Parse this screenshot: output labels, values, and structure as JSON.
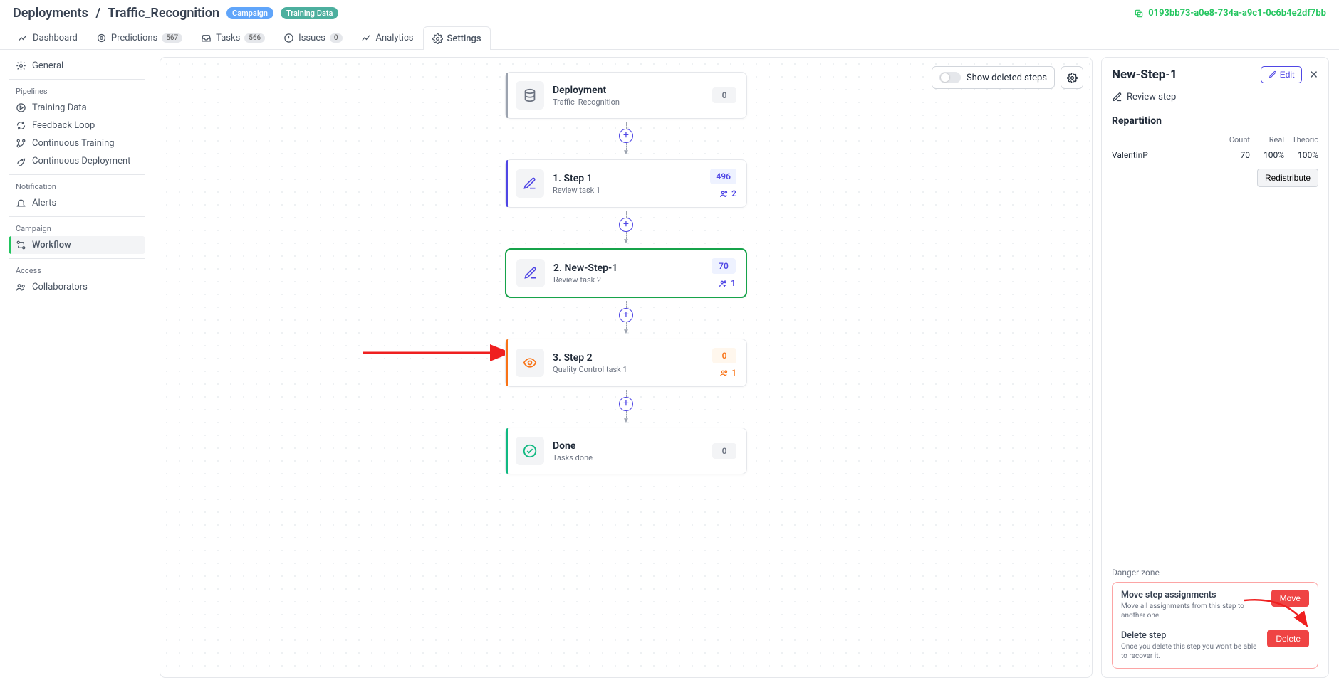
{
  "breadcrumb": {
    "root": "Deployments",
    "current": "Traffic_Recognition"
  },
  "badges": {
    "campaign": "Campaign",
    "training": "Training Data"
  },
  "identifier": "0193bb73-a0e8-734a-a9c1-0c6b4e2df7bb",
  "tabs": {
    "dashboard": "Dashboard",
    "predictions": "Predictions",
    "predictions_count": "567",
    "tasks": "Tasks",
    "tasks_count": "566",
    "issues": "Issues",
    "issues_count": "0",
    "analytics": "Analytics",
    "settings": "Settings"
  },
  "sidebar": {
    "general": "General",
    "pipelines_heading": "Pipelines",
    "training_data": "Training Data",
    "feedback_loop": "Feedback Loop",
    "continuous_training": "Continuous Training",
    "continuous_deployment": "Continuous Deployment",
    "notification_heading": "Notification",
    "alerts": "Alerts",
    "campaign_heading": "Campaign",
    "workflow": "Workflow",
    "access_heading": "Access",
    "collaborators": "Collaborators"
  },
  "canvas": {
    "show_deleted": "Show deleted steps",
    "nodes": {
      "deployment": {
        "title": "Deployment",
        "sub": "Traffic_Recognition",
        "count": "0"
      },
      "step1": {
        "title": "1. Step 1",
        "sub": "Review task 1",
        "count": "496",
        "people": "2"
      },
      "step2": {
        "title": "2. New-Step-1",
        "sub": "Review task 2",
        "count": "70",
        "people": "1"
      },
      "step3": {
        "title": "3. Step 2",
        "sub": "Quality Control task 1",
        "count": "0",
        "people": "1"
      },
      "done": {
        "title": "Done",
        "sub": "Tasks done",
        "count": "0"
      }
    }
  },
  "rightpanel": {
    "title": "New-Step-1",
    "edit": "Edit",
    "subtitle": "Review step",
    "repartition_heading": "Repartition",
    "table_head": {
      "count": "Count",
      "real": "Real",
      "theoric": "Theoric"
    },
    "row": {
      "name": "ValentinP",
      "count": "70",
      "real": "100%",
      "theoric": "100%"
    },
    "redistribute": "Redistribute",
    "danger_heading": "Danger zone",
    "move": {
      "title": "Move step assignments",
      "desc": "Move all assignments from this step to another one.",
      "btn": "Move"
    },
    "delete": {
      "title": "Delete step",
      "desc": "Once you delete this step you won't be able to recover it.",
      "btn": "Delete"
    }
  }
}
